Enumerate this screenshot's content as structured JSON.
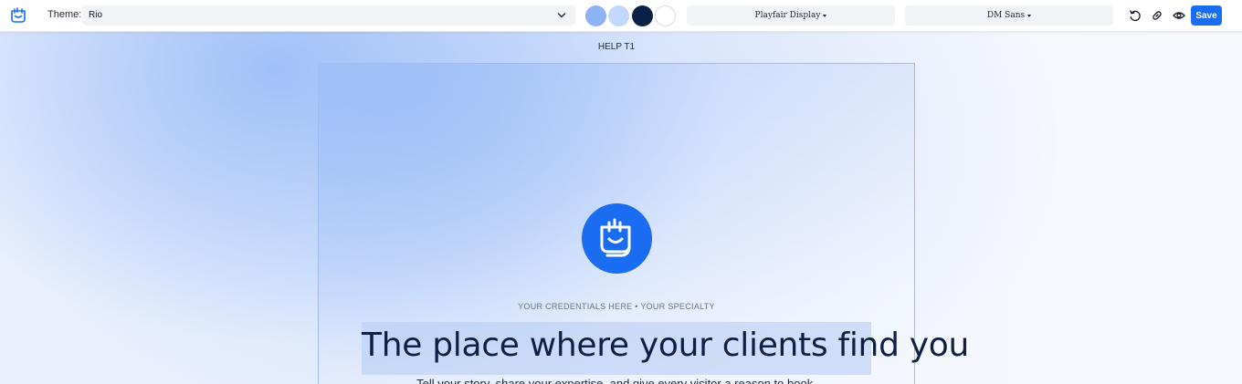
{
  "toolbar": {
    "logo_icon": "calendar-smile-icon",
    "theme_label": "Theme:",
    "theme_value": "Rio",
    "theme_chevron_icon": "chevron-down-icon",
    "swatches": [
      "#8db3f5",
      "#c2d7fb",
      "#0c1f47",
      "#ffffff"
    ],
    "heading_font": "Playfair Display",
    "body_font": "DM Sans",
    "actions": {
      "undo_icon": "undo-icon",
      "link_icon": "link-icon",
      "preview_icon": "eye-icon",
      "save_label": "Save"
    },
    "accent_color": "#1a6cf0"
  },
  "canvas": {
    "page_name": "HELP T1",
    "hero": {
      "logo_icon": "calendar-smile-icon",
      "credentials": "YOUR CREDENTIALS HERE • YOUR SPECIALTY",
      "headline": "The place where your clients find you",
      "subtext": "Tell your story, share your expertise, and give every visitor a reason to book."
    }
  }
}
